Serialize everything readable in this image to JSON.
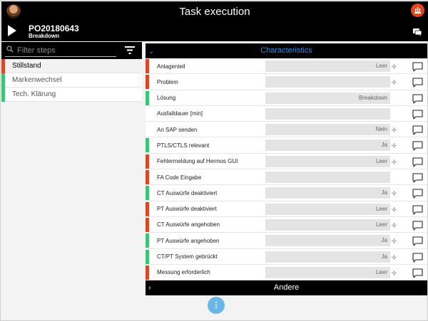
{
  "header": {
    "title": "Task execution",
    "order_number": "PO20180643",
    "order_type": "Breakdown"
  },
  "filter": {
    "placeholder": "Filter steps"
  },
  "steps": [
    {
      "label": "Stillstand",
      "status_color": "#e8431d",
      "active": true
    },
    {
      "label": "Markenwechsel",
      "status_color": "#2fcc71",
      "active": false
    },
    {
      "label": "Tech. Klärung",
      "status_color": "#2fcc71",
      "active": false
    }
  ],
  "panel": {
    "title": "Characteristics",
    "footer_title": "Andere",
    "rows": [
      {
        "label": "Anlagenteil",
        "value": "Leer",
        "status_color": "#e8431d",
        "spark": true
      },
      {
        "label": "Problem",
        "value": "",
        "status_color": "#e8431d",
        "spark": true
      },
      {
        "label": "Lösung",
        "value": "Breakdown",
        "status_color": "#2fcc71",
        "spark": false
      },
      {
        "label": "Ausfalldauer [min]",
        "value": "",
        "status_color": "",
        "spark": false
      },
      {
        "label": "An SAP senden",
        "value": "Nein",
        "status_color": "",
        "spark": true
      },
      {
        "label": "PTLS/CTLS relevant",
        "value": "Ja",
        "status_color": "#2fcc71",
        "spark": true
      },
      {
        "label": "Fehlermeldung auf Hermos GUI",
        "value": "Leer",
        "status_color": "#e8431d",
        "spark": true
      },
      {
        "label": "FA Code Eingabe",
        "value": "",
        "status_color": "#e8431d",
        "spark": false
      },
      {
        "label": "CT Auswürfe deaktiviert",
        "value": "Ja",
        "status_color": "#2fcc71",
        "spark": true
      },
      {
        "label": "PT Auswürfe deaktiviert",
        "value": "Leer",
        "status_color": "#e8431d",
        "spark": true
      },
      {
        "label": "CT Auswürfe angehoben",
        "value": "Leer",
        "status_color": "#e8431d",
        "spark": true
      },
      {
        "label": "PT Auswürfe angehoben",
        "value": "Ja",
        "status_color": "#2fcc71",
        "spark": true
      },
      {
        "label": "CT/PT System gebrückt",
        "value": "Ja",
        "status_color": "#2fcc71",
        "spark": true
      },
      {
        "label": "Messung erforderlich",
        "value": "Leer",
        "status_color": "#e8431d",
        "spark": true
      }
    ]
  },
  "fab": {
    "label": "⋮"
  },
  "icons": {
    "alert": "fire-alarm-icon",
    "play": "play-icon",
    "chat": "chat-icon",
    "search": "search-icon",
    "filter": "filter-icon",
    "comment": "comment-icon",
    "spark": "sparkle-icon"
  }
}
